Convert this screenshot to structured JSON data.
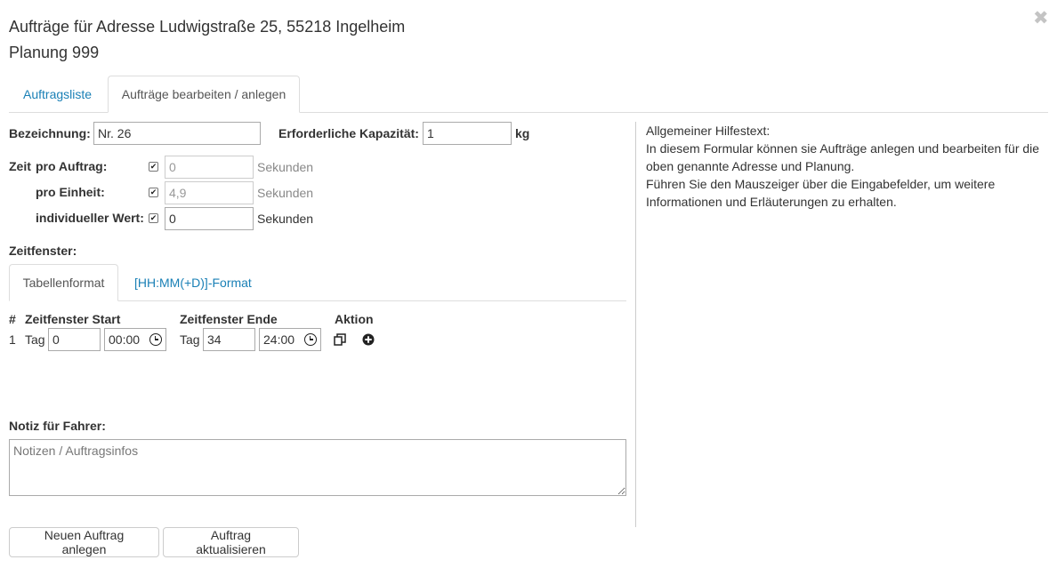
{
  "modal": {
    "title_line1": "Aufträge für Adresse Ludwigstraße 25, 55218 Ingelheim",
    "title_line2": "Planung 999",
    "close_symbol": "✖"
  },
  "tabs": [
    {
      "label": "Auftragsliste",
      "active": false
    },
    {
      "label": "Aufträge bearbeiten / anlegen",
      "active": true
    }
  ],
  "form": {
    "bezeichnung_label": "Bezeichnung:",
    "bezeichnung_value": "Nr. 26",
    "kapazitaet_label": "Erforderliche Kapazität:",
    "kapazitaet_value": "1",
    "kapazitaet_unit": "kg",
    "zeit_label": "Zeit",
    "pro_auftrag_label": "pro Auftrag:",
    "pro_auftrag_placeholder": "0",
    "pro_auftrag_checked": true,
    "pro_auftrag_unit": "Sekunden",
    "pro_einheit_label": "pro Einheit:",
    "pro_einheit_placeholder": "4,9",
    "pro_einheit_checked": true,
    "pro_einheit_unit": "Sekunden",
    "individuell_label": "individueller Wert:",
    "individuell_value": "0",
    "individuell_checked": true,
    "individuell_unit": "Sekunden",
    "checkbox_mark": "✔"
  },
  "zeitfenster": {
    "label": "Zeitfenster:",
    "tabs": [
      {
        "label": "Tabellenformat",
        "active": true
      },
      {
        "label": "[HH:MM(+D)]-Format",
        "active": false
      }
    ],
    "headers": {
      "index": "#",
      "start": "Zeitfenster Start",
      "end": "Zeitfenster Ende",
      "action": "Aktion"
    },
    "rows": [
      {
        "index": "1",
        "start_tag_label": "Tag",
        "start_tag": "0",
        "start_time": "00:00",
        "end_tag_label": "Tag",
        "end_tag": "34",
        "end_time": "24:00",
        "actions": [
          "copy-icon",
          "plus-circle-icon"
        ]
      }
    ]
  },
  "notiz": {
    "label": "Notiz für Fahrer:",
    "placeholder": "Notizen / Auftragsinfos",
    "value": ""
  },
  "buttons": {
    "neu": "Neuen Auftrag anlegen",
    "aktualisieren": "Auftrag aktualisieren"
  },
  "help": {
    "heading": "Allgemeiner Hilfestext:",
    "line1": "In diesem Formular können sie Aufträge anlegen und bearbeiten für die oben genannte Adresse und Planung.",
    "line2": "Führen Sie den Mauszeiger über die Eingabefelder, um weitere Informationen und Erläuterungen zu erhalten."
  }
}
